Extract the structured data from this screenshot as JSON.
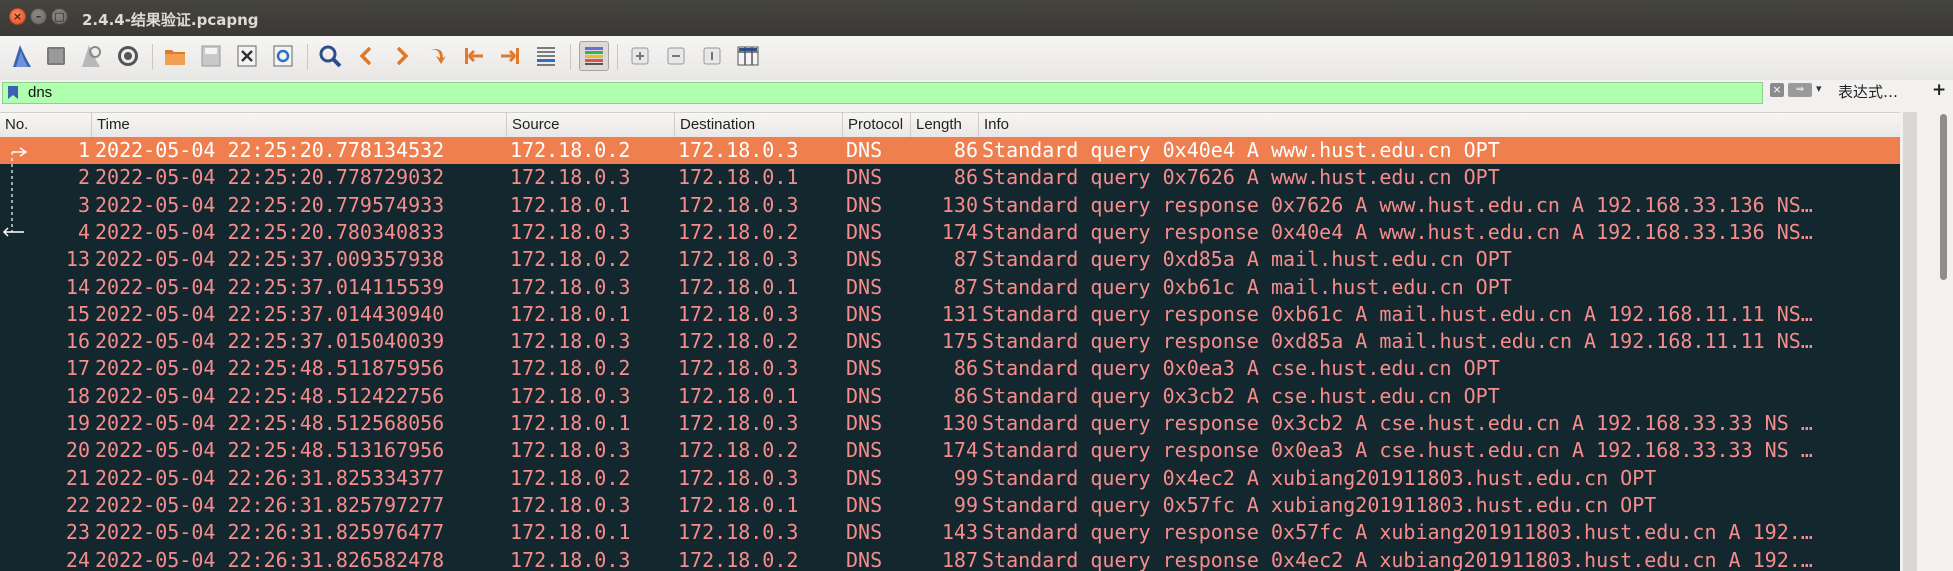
{
  "window": {
    "title": "2.4.4-结果验证.pcapng"
  },
  "toolbar": {
    "buttons": [
      "start-capture-icon",
      "stop-capture-icon",
      "restart-capture-icon",
      "capture-options-icon",
      "open-file-icon",
      "save-file-icon",
      "close-file-icon",
      "reload-file-icon",
      "find-packet-icon",
      "go-back-icon",
      "go-forward-icon",
      "go-to-packet-icon",
      "go-first-icon",
      "go-last-icon",
      "autoscroll-icon",
      "colorize-icon",
      "zoom-in-icon",
      "zoom-out-icon",
      "normal-size-icon",
      "resize-columns-icon"
    ]
  },
  "filter": {
    "value": "dns",
    "expression_label": "表达式…",
    "plus_label": "+"
  },
  "colors": {
    "selected_row": "#f07f4f",
    "row_bg": "#12272e",
    "row_text": "#f78c8c",
    "filter_bg": "#afffaf"
  },
  "columns": [
    "No.",
    "Time",
    "Source",
    "Destination",
    "Protocol",
    "Length",
    "Info"
  ],
  "packets": [
    {
      "no": "1",
      "time": "2022-05-04 22:25:20.778134532",
      "src": "172.18.0.2",
      "dst": "172.18.0.3",
      "proto": "DNS",
      "len": "86",
      "info": "Standard query 0x40e4 A www.hust.edu.cn OPT",
      "selected": true
    },
    {
      "no": "2",
      "time": "2022-05-04 22:25:20.778729032",
      "src": "172.18.0.3",
      "dst": "172.18.0.1",
      "proto": "DNS",
      "len": "86",
      "info": "Standard query 0x7626 A www.hust.edu.cn OPT"
    },
    {
      "no": "3",
      "time": "2022-05-04 22:25:20.779574933",
      "src": "172.18.0.1",
      "dst": "172.18.0.3",
      "proto": "DNS",
      "len": "130",
      "info": "Standard query response 0x7626 A www.hust.edu.cn A 192.168.33.136 NS…"
    },
    {
      "no": "4",
      "time": "2022-05-04 22:25:20.780340833",
      "src": "172.18.0.3",
      "dst": "172.18.0.2",
      "proto": "DNS",
      "len": "174",
      "info": "Standard query response 0x40e4 A www.hust.edu.cn A 192.168.33.136 NS…"
    },
    {
      "no": "13",
      "time": "2022-05-04 22:25:37.009357938",
      "src": "172.18.0.2",
      "dst": "172.18.0.3",
      "proto": "DNS",
      "len": "87",
      "info": "Standard query 0xd85a A mail.hust.edu.cn OPT"
    },
    {
      "no": "14",
      "time": "2022-05-04 22:25:37.014115539",
      "src": "172.18.0.3",
      "dst": "172.18.0.1",
      "proto": "DNS",
      "len": "87",
      "info": "Standard query 0xb61c A mail.hust.edu.cn OPT"
    },
    {
      "no": "15",
      "time": "2022-05-04 22:25:37.014430940",
      "src": "172.18.0.1",
      "dst": "172.18.0.3",
      "proto": "DNS",
      "len": "131",
      "info": "Standard query response 0xb61c A mail.hust.edu.cn A 192.168.11.11 NS…"
    },
    {
      "no": "16",
      "time": "2022-05-04 22:25:37.015040039",
      "src": "172.18.0.3",
      "dst": "172.18.0.2",
      "proto": "DNS",
      "len": "175",
      "info": "Standard query response 0xd85a A mail.hust.edu.cn A 192.168.11.11 NS…"
    },
    {
      "no": "17",
      "time": "2022-05-04 22:25:48.511875956",
      "src": "172.18.0.2",
      "dst": "172.18.0.3",
      "proto": "DNS",
      "len": "86",
      "info": "Standard query 0x0ea3 A cse.hust.edu.cn OPT"
    },
    {
      "no": "18",
      "time": "2022-05-04 22:25:48.512422756",
      "src": "172.18.0.3",
      "dst": "172.18.0.1",
      "proto": "DNS",
      "len": "86",
      "info": "Standard query 0x3cb2 A cse.hust.edu.cn OPT"
    },
    {
      "no": "19",
      "time": "2022-05-04 22:25:48.512568056",
      "src": "172.18.0.1",
      "dst": "172.18.0.3",
      "proto": "DNS",
      "len": "130",
      "info": "Standard query response 0x3cb2 A cse.hust.edu.cn A 192.168.33.33 NS …"
    },
    {
      "no": "20",
      "time": "2022-05-04 22:25:48.513167956",
      "src": "172.18.0.3",
      "dst": "172.18.0.2",
      "proto": "DNS",
      "len": "174",
      "info": "Standard query response 0x0ea3 A cse.hust.edu.cn A 192.168.33.33 NS …"
    },
    {
      "no": "21",
      "time": "2022-05-04 22:26:31.825334377",
      "src": "172.18.0.2",
      "dst": "172.18.0.3",
      "proto": "DNS",
      "len": "99",
      "info": "Standard query 0x4ec2 A xubiang201911803.hust.edu.cn OPT"
    },
    {
      "no": "22",
      "time": "2022-05-04 22:26:31.825797277",
      "src": "172.18.0.3",
      "dst": "172.18.0.1",
      "proto": "DNS",
      "len": "99",
      "info": "Standard query 0x57fc A xubiang201911803.hust.edu.cn OPT"
    },
    {
      "no": "23",
      "time": "2022-05-04 22:26:31.825976477",
      "src": "172.18.0.1",
      "dst": "172.18.0.3",
      "proto": "DNS",
      "len": "143",
      "info": "Standard query response 0x57fc A xubiang201911803.hust.edu.cn A 192.…"
    },
    {
      "no": "24",
      "time": "2022-05-04 22:26:31.826582478",
      "src": "172.18.0.3",
      "dst": "172.18.0.2",
      "proto": "DNS",
      "len": "187",
      "info": "Standard query response 0x4ec2 A xubiang201911803.hust.edu.cn A 192.…"
    }
  ]
}
